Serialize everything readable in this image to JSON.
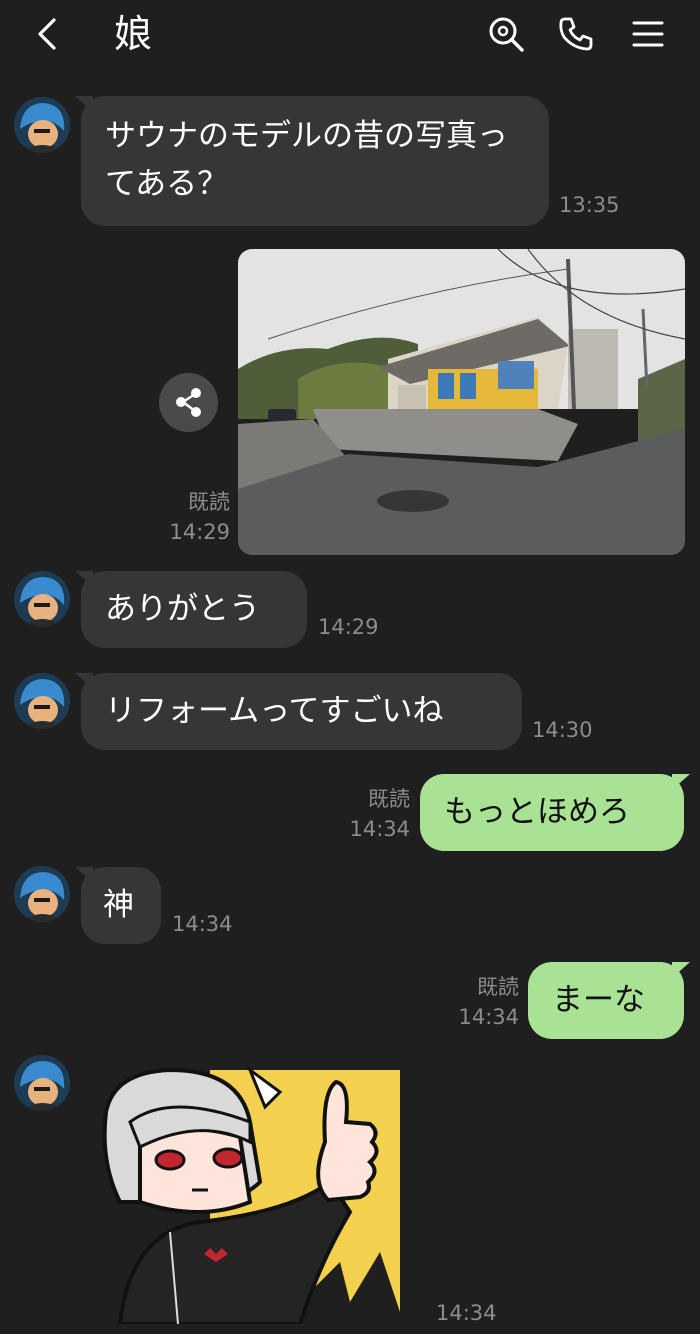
{
  "header": {
    "title": "娘"
  },
  "messages": [
    {
      "text": "サウナのモデルの昔の写真ってある？",
      "time": "13:35"
    },
    {
      "time": "14:29",
      "read": "既読"
    },
    {
      "text": "ありがとう",
      "time": "14:29"
    },
    {
      "text": "リフォームってすごいね",
      "time": "14:30"
    },
    {
      "text": "もっとほめろ",
      "time": "14:34",
      "read": "既読"
    },
    {
      "text": "神",
      "time": "14:34"
    },
    {
      "text": "まーな",
      "time": "14:34",
      "read": "既読"
    },
    {
      "time": "14:34"
    }
  ],
  "icons": {
    "back": "chevron-left-icon",
    "search": "search-icon",
    "call": "phone-icon",
    "menu": "hamburger-menu-icon",
    "share": "share-icon"
  },
  "colors": {
    "background": "#1f1f1f",
    "incoming_bubble": "#363636",
    "outgoing_bubble": "#a9e294",
    "meta_text": "#8c8c8c"
  }
}
